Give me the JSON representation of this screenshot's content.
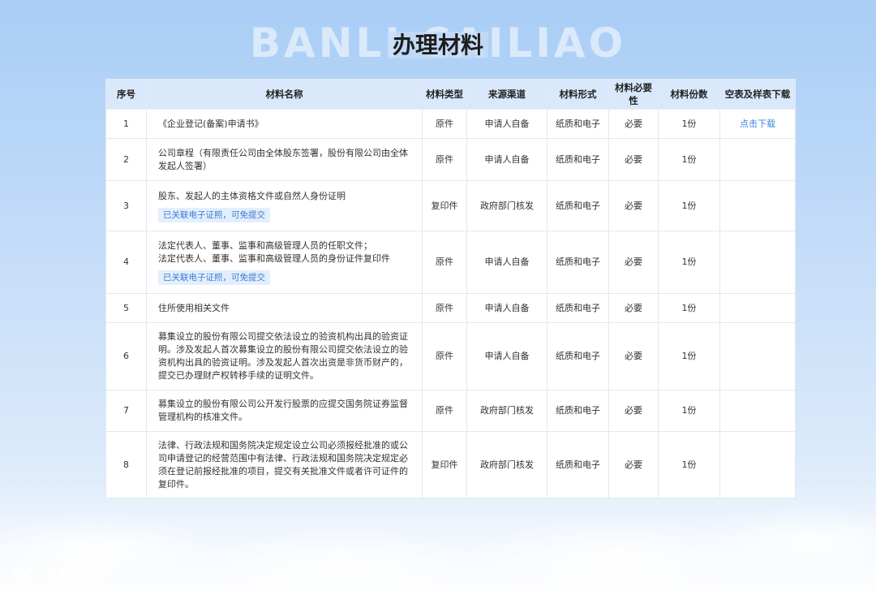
{
  "header": {
    "bg_text": "BANLI CAILIAO",
    "title": "办理材料"
  },
  "table": {
    "columns": [
      "序号",
      "材料名称",
      "材料类型",
      "来源渠道",
      "材料形式",
      "材料必要性",
      "材料份数",
      "空表及样表下载"
    ],
    "rows": [
      {
        "no": "1",
        "name": "《企业登记(备案)申请书》",
        "tag": "",
        "type": "原件",
        "source": "申请人自备",
        "form": "纸质和电子",
        "necessity": "必要",
        "copies": "1份",
        "download": "点击下载"
      },
      {
        "no": "2",
        "name": "公司章程（有限责任公司由全体股东签署，股份有限公司由全体发起人签署）",
        "tag": "",
        "type": "原件",
        "source": "申请人自备",
        "form": "纸质和电子",
        "necessity": "必要",
        "copies": "1份",
        "download": ""
      },
      {
        "no": "3",
        "name": "股东、发起人的主体资格文件或自然人身份证明",
        "tag": "已关联电子证照，可免提交",
        "type": "复印件",
        "source": "政府部门核发",
        "form": "纸质和电子",
        "necessity": "必要",
        "copies": "1份",
        "download": ""
      },
      {
        "no": "4",
        "name": "法定代表人、董事、监事和高级管理人员的任职文件；\n法定代表人、董事、监事和高级管理人员的身份证件复印件",
        "tag": "已关联电子证照，可免提交",
        "type": "原件",
        "source": "申请人自备",
        "form": "纸质和电子",
        "necessity": "必要",
        "copies": "1份",
        "download": ""
      },
      {
        "no": "5",
        "name": "住所使用相关文件",
        "tag": "",
        "type": "原件",
        "source": "申请人自备",
        "form": "纸质和电子",
        "necessity": "必要",
        "copies": "1份",
        "download": ""
      },
      {
        "no": "6",
        "name": "募集设立的股份有限公司提交依法设立的验资机构出具的验资证明。涉及发起人首次募集设立的股份有限公司提交依法设立的验资机构出具的验资证明。涉及发起人首次出资是非货币财产的，提交已办理财产权转移手续的证明文件。",
        "tag": "",
        "type": "原件",
        "source": "申请人自备",
        "form": "纸质和电子",
        "necessity": "必要",
        "copies": "1份",
        "download": ""
      },
      {
        "no": "7",
        "name": "募集设立的股份有限公司公开发行股票的应提交国务院证券监督管理机构的核准文件。",
        "tag": "",
        "type": "原件",
        "source": "政府部门核发",
        "form": "纸质和电子",
        "necessity": "必要",
        "copies": "1份",
        "download": ""
      },
      {
        "no": "8",
        "name": "法律、行政法规和国务院决定规定设立公司必须报经批准的或公司申请登记的经营范围中有法律、行政法规和国务院决定规定必须在登记前报经批准的项目，提交有关批准文件或者许可证件的复印件。",
        "tag": "",
        "type": "复印件",
        "source": "政府部门核发",
        "form": "纸质和电子",
        "necessity": "必要",
        "copies": "1份",
        "download": ""
      }
    ]
  },
  "watermark": {
    "text": "大数跨境",
    "icon": "brand-logo-icon"
  }
}
